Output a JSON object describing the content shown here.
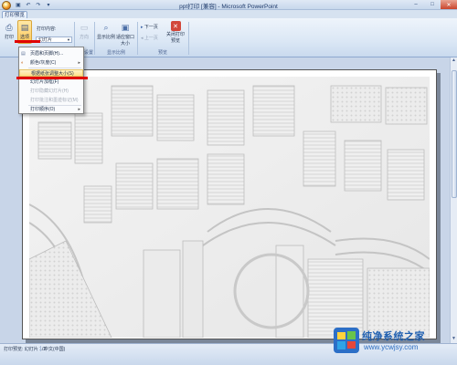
{
  "window": {
    "title": "ppt打印 [兼容] - Microsoft PowerPoint",
    "min": "–",
    "max": "□",
    "close": "✕"
  },
  "qat": [
    {
      "name": "save",
      "glyph": "▣"
    },
    {
      "name": "undo",
      "glyph": "↶"
    },
    {
      "name": "redo",
      "glyph": "↷"
    },
    {
      "name": "customize",
      "glyph": "▾"
    }
  ],
  "ribbon": {
    "active_tab": "打印预览",
    "print": {
      "label": "打印",
      "icon": "printer-icon",
      "glyph": "⎙"
    },
    "options": {
      "label": "选项",
      "icon": "options-icon",
      "glyph": "▤"
    },
    "print_what_label": "打印内容:",
    "print_what_value": "幻灯片",
    "orientation_label": "方向",
    "orientation_glyph": "▭",
    "page_setup_label": "页面设置",
    "show_ruler_label": "显示比例",
    "zoom_fit_label": "适应窗口大小",
    "next_page": "下一页",
    "prev_page": "上一页",
    "close_preview": "关闭打印预览",
    "group_print": "打印",
    "group_page_setup": "页面设置",
    "group_zoom": "显示比例",
    "group_preview": "预览"
  },
  "menu": {
    "items": [
      {
        "label": "页眉和页脚(H)...",
        "disabled": false,
        "submenu": false,
        "icon": "header-footer-icon"
      },
      {
        "label": "颜色/灰度(C)",
        "disabled": false,
        "submenu": true,
        "icon": "color-icon"
      },
      {
        "label": "根据纸张调整大小(S)",
        "disabled": false,
        "submenu": false,
        "highlight": true,
        "icon": ""
      },
      {
        "label": "幻灯片加框(F)",
        "disabled": false,
        "submenu": false,
        "icon": ""
      },
      {
        "label": "打印隐藏幻灯片(H)",
        "disabled": true,
        "submenu": false,
        "icon": ""
      },
      {
        "label": "打印批注和墨迹标记(M)",
        "disabled": true,
        "submenu": false,
        "icon": ""
      },
      {
        "label": "打印顺序(O)",
        "disabled": false,
        "submenu": true,
        "icon": ""
      }
    ]
  },
  "status": {
    "page": "打印预览: 幻灯片 1/2",
    "language": "中文(中国)"
  },
  "watermark": {
    "name": "纯净系统之家",
    "url": "www.ycwjsy.com"
  }
}
